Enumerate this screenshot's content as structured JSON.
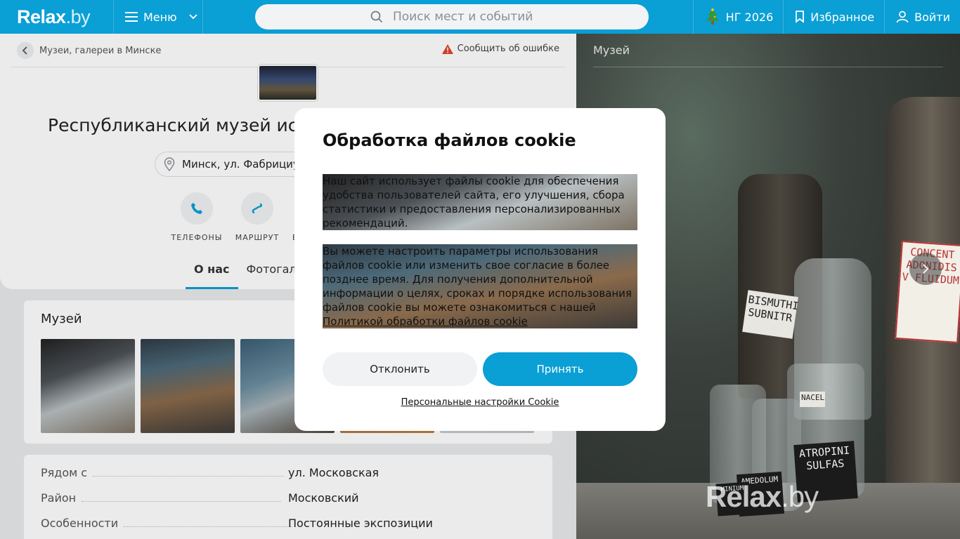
{
  "header": {
    "logo": "Relax",
    "logo_suffix": ".by",
    "menu_label": "Меню",
    "search_placeholder": "Поиск мест и событий",
    "ny_label": "НГ 2026",
    "favorites_label": "Избранное",
    "login_label": "Войти"
  },
  "breadcrumb": {
    "label": "Музеи, галереи в Минске"
  },
  "report_label": "Сообщить об ошибке",
  "place": {
    "title": "Республиканский музей ист",
    "address": "Минск, ул. Фабрициу"
  },
  "actions": [
    {
      "label": "ТЕЛЕФОНЫ",
      "icon": "phone-icon"
    },
    {
      "label": "МАРШРУТ",
      "icon": "route-icon"
    },
    {
      "label": "В",
      "icon": ""
    }
  ],
  "tabs": [
    {
      "label": "О нас",
      "active": true
    },
    {
      "label": "Фотогале",
      "active": false
    }
  ],
  "museum_card": {
    "title": "Музей"
  },
  "info": [
    {
      "label": "Рядом с",
      "value": "ул. Московская"
    },
    {
      "label": "Район",
      "value": "Московский"
    },
    {
      "label": "Особенности",
      "value": "Постоянные экспозиции"
    }
  ],
  "right_photo": {
    "category": "Музей",
    "bottle_labels": [
      "BISMUTHI SUBNITR",
      "CONCENT ADONIDIS V FLUIDUM",
      "ATROPINI SULFAS",
      "AMEDOLUM",
      "MINIUM",
      "NACEL"
    ],
    "watermark": "Relax",
    "watermark_suffix": ".by"
  },
  "cookie": {
    "title": "Обработка файлов cookie",
    "paragraph1": "Наш сайт использует файлы cookie для обеспечения удобства пользователей сайта, его улучшения, сбора статистики и предоставления персонализированных рекомендаций.",
    "paragraph2": "Вы можете настроить параметры использования файлов cookie или изменить свое согласие в более позднее время. Для получения дополнительной информации о целях, сроках и порядке использования файлов cookie вы можете ознакомиться с нашей",
    "policy_link": "Политикой обработки файлов cookie",
    "decline": "Отклонить",
    "accept": "Принять",
    "personal_settings": "Персональные настройки Cookie"
  },
  "colors": {
    "brand": "#0a9fd5",
    "warning": "#e0452b"
  }
}
